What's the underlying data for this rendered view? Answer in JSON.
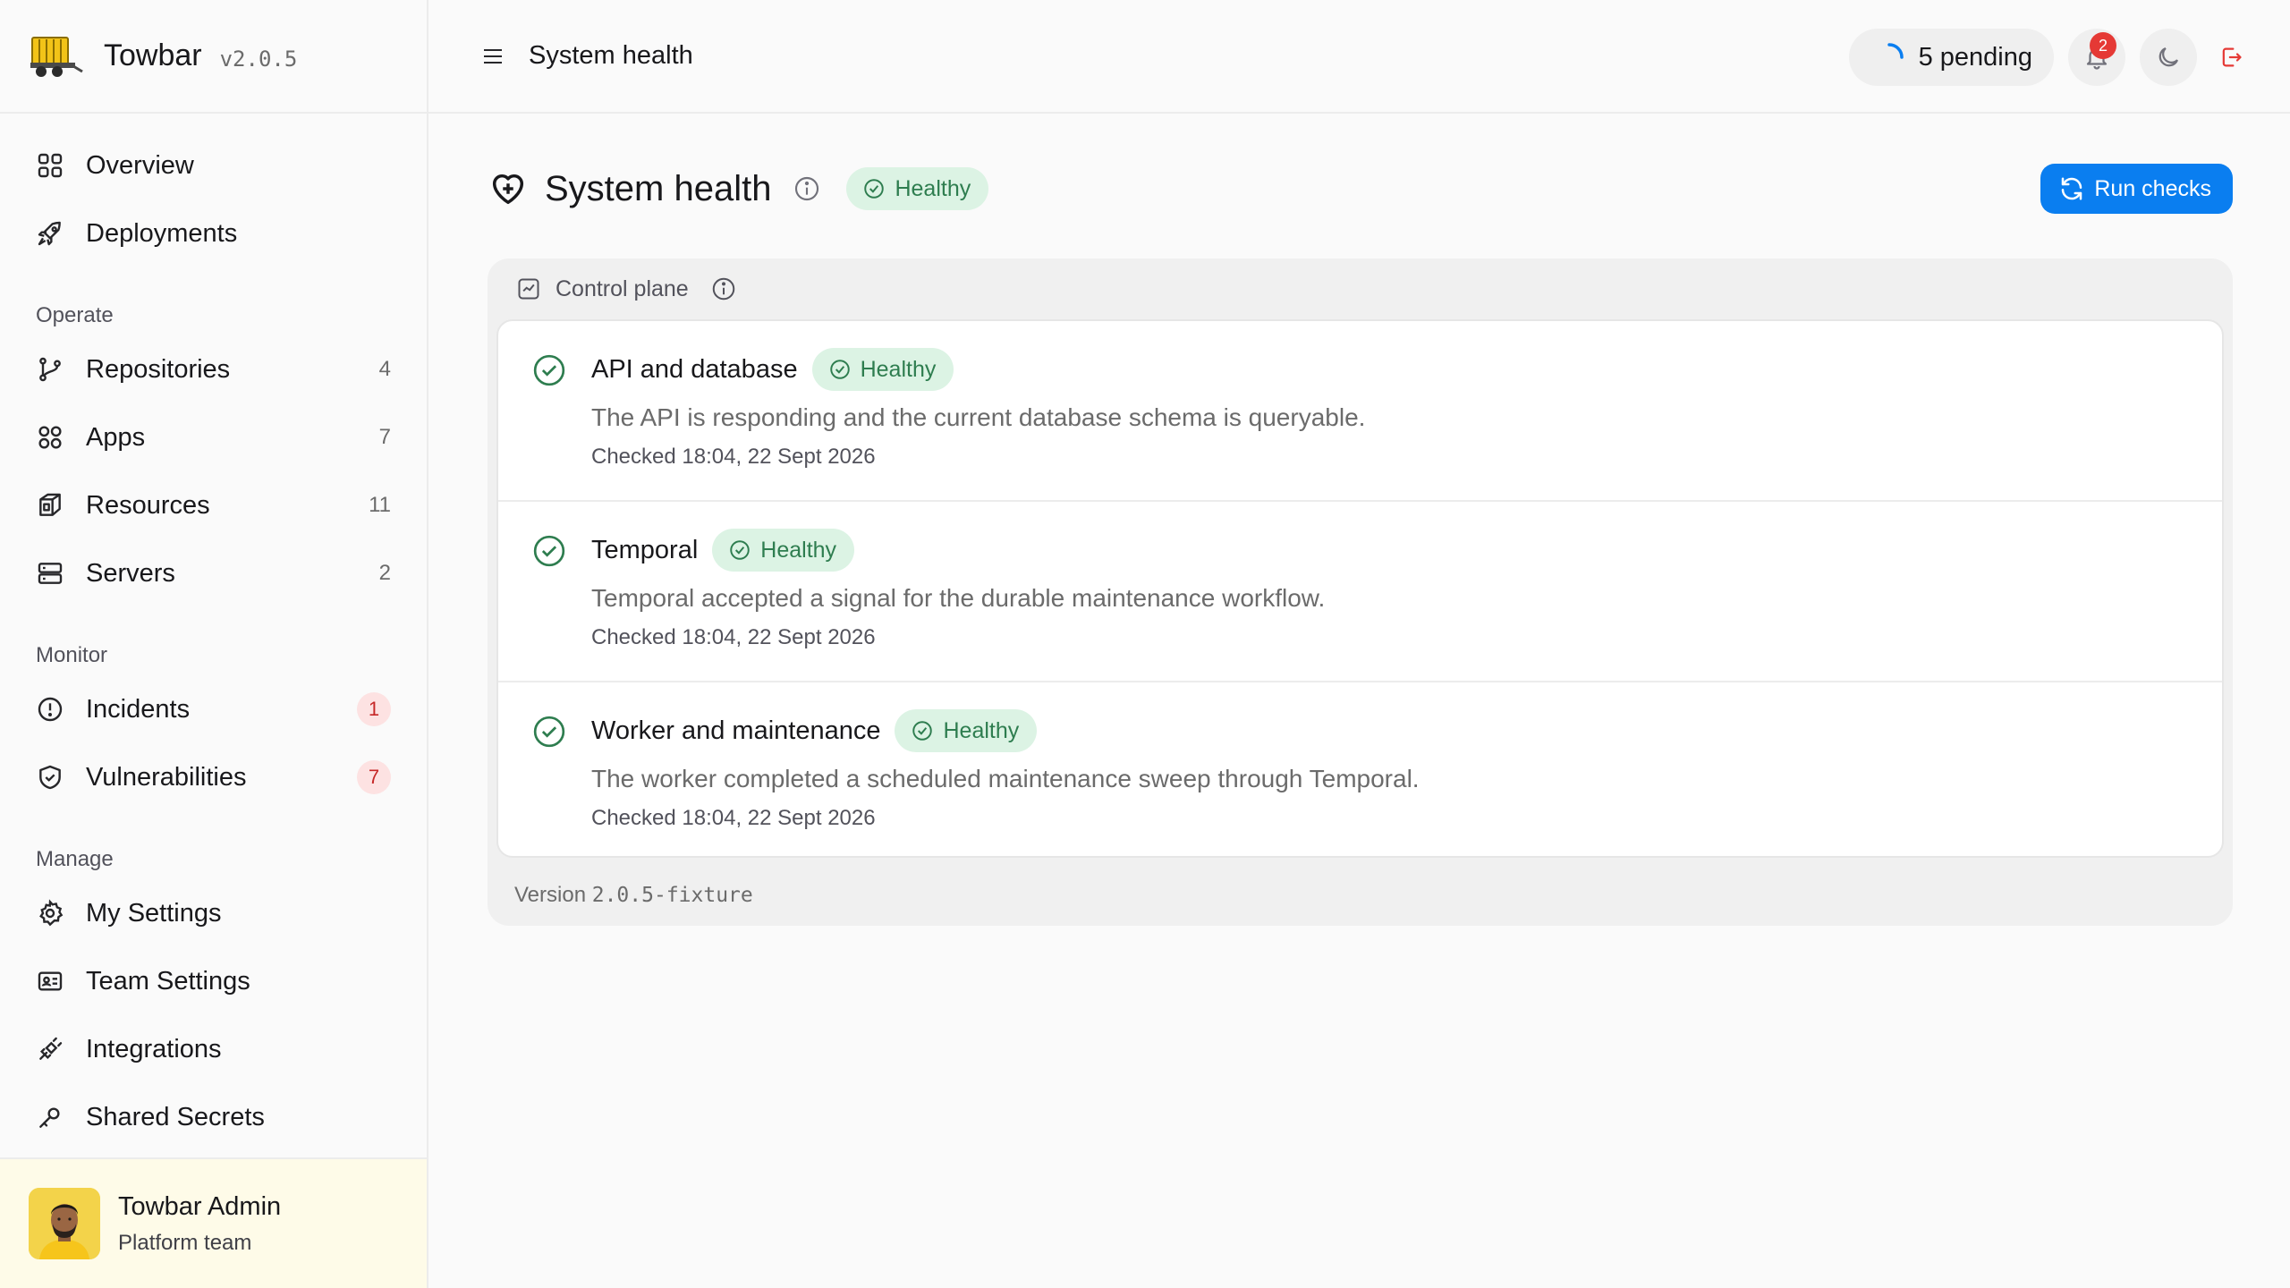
{
  "app": {
    "name": "Towbar",
    "version": "v2.0.5"
  },
  "sidebar": {
    "top_items": [
      {
        "label": "Overview",
        "icon": "grid-icon"
      },
      {
        "label": "Deployments",
        "icon": "rocket-icon"
      }
    ],
    "sections": [
      {
        "title": "Operate",
        "items": [
          {
            "label": "Repositories",
            "icon": "git-branch-icon",
            "count": "4"
          },
          {
            "label": "Apps",
            "icon": "grid-icon",
            "count": "7"
          },
          {
            "label": "Resources",
            "icon": "box-icon",
            "count": "11"
          },
          {
            "label": "Servers",
            "icon": "server-icon",
            "count": "2"
          }
        ]
      },
      {
        "title": "Monitor",
        "items": [
          {
            "label": "Incidents",
            "icon": "alert-circle-icon",
            "badge": "1"
          },
          {
            "label": "Vulnerabilities",
            "icon": "shield-icon",
            "badge": "7"
          }
        ]
      },
      {
        "title": "Manage",
        "items": [
          {
            "label": "My Settings",
            "icon": "gear-icon"
          },
          {
            "label": "Team Settings",
            "icon": "id-card-icon"
          },
          {
            "label": "Integrations",
            "icon": "plug-icon"
          },
          {
            "label": "Shared Secrets",
            "icon": "key-icon"
          }
        ]
      }
    ],
    "user": {
      "name": "Towbar Admin",
      "team": "Platform team"
    }
  },
  "topbar": {
    "breadcrumb": "System health",
    "pending_label": "5 pending",
    "notification_count": "2"
  },
  "page": {
    "title": "System health",
    "status": "Healthy",
    "run_checks_label": "Run checks",
    "panel_title": "Control plane",
    "checks": [
      {
        "name": "API and database",
        "status": "Healthy",
        "description": "The API is responding and the current database schema is queryable.",
        "checked": "Checked 18:04, 22 Sept 2026"
      },
      {
        "name": "Temporal",
        "status": "Healthy",
        "description": "Temporal accepted a signal for the durable maintenance workflow.",
        "checked": "Checked 18:04, 22 Sept 2026"
      },
      {
        "name": "Worker and maintenance",
        "status": "Healthy",
        "description": "The worker completed a scheduled maintenance sweep through Temporal.",
        "checked": "Checked 18:04, 22 Sept 2026"
      }
    ],
    "version_label": "Version",
    "version_value": "2.0.5-fixture"
  },
  "colors": {
    "accent": "#0a7ef0",
    "healthy_bg": "#dcf3e4",
    "healthy_fg": "#2e7d4f",
    "danger": "#e53935"
  }
}
